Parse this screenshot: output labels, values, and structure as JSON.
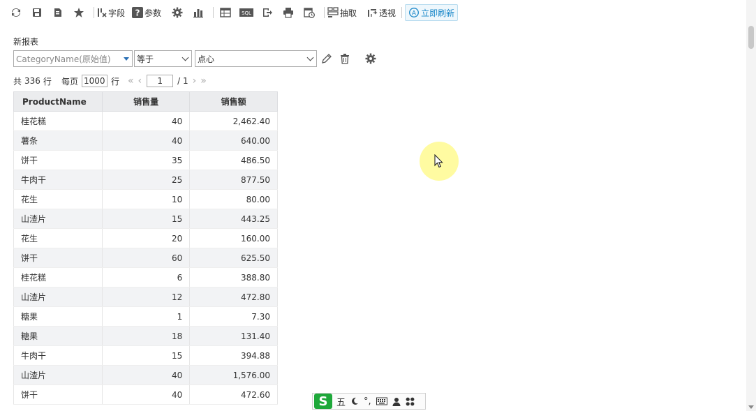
{
  "toolbar": {
    "field_label": "字段",
    "param_label": "参数",
    "extract_label": "抽取",
    "pivot_label": "透视",
    "refresh_label": "立即刷新",
    "sql_label": "SQL"
  },
  "report": {
    "title": "新报表"
  },
  "filter": {
    "field": "CategoryName(原始值)",
    "operator": "等于",
    "value": "点心"
  },
  "pager": {
    "total_prefix": "共",
    "total_count": "336",
    "total_suffix": "行",
    "per_page_label": "每页",
    "per_page_value": "1000",
    "per_page_unit": "行",
    "current_page": "1",
    "total_pages": "/ 1"
  },
  "table": {
    "headers": [
      "ProductName",
      "销售量",
      "销售额"
    ],
    "rows": [
      [
        "桂花糕",
        "40",
        "2,462.40"
      ],
      [
        "薯条",
        "40",
        "640.00"
      ],
      [
        "饼干",
        "35",
        "486.50"
      ],
      [
        "牛肉干",
        "25",
        "877.50"
      ],
      [
        "花生",
        "10",
        "80.00"
      ],
      [
        "山渣片",
        "15",
        "443.25"
      ],
      [
        "花生",
        "20",
        "160.00"
      ],
      [
        "饼干",
        "60",
        "625.50"
      ],
      [
        "桂花糕",
        "6",
        "388.80"
      ],
      [
        "山渣片",
        "12",
        "472.80"
      ],
      [
        "糖果",
        "1",
        "7.30"
      ],
      [
        "糖果",
        "18",
        "131.40"
      ],
      [
        "牛肉干",
        "15",
        "394.88"
      ],
      [
        "山渣片",
        "40",
        "1,576.00"
      ],
      [
        "饼干",
        "40",
        "472.60"
      ]
    ]
  },
  "ime": {
    "logo": "S",
    "mode": "五",
    "punct": "°,"
  }
}
